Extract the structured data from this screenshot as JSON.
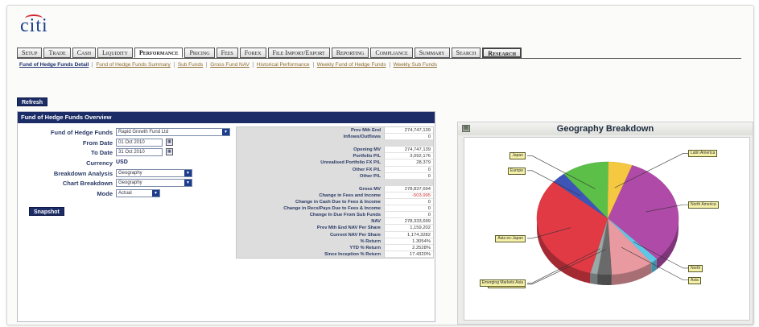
{
  "brand": {
    "logo_text": "citi"
  },
  "tabs": [
    {
      "label": "Setup"
    },
    {
      "label": "Trade"
    },
    {
      "label": "Cash"
    },
    {
      "label": "Liquidity"
    },
    {
      "label": "Performance",
      "active": true
    },
    {
      "label": "Pricing"
    },
    {
      "label": "Fees"
    },
    {
      "label": "Forex"
    },
    {
      "label": "File Import/Export"
    },
    {
      "label": "Reporting"
    },
    {
      "label": "Compliance"
    },
    {
      "label": "Summary"
    },
    {
      "label": "Search"
    },
    {
      "label": "Research"
    }
  ],
  "subnav": [
    "Fund of Hedge Funds Detail",
    "Fund of Hedge Funds Summary",
    "Sub Funds",
    "Gross Fund NAV",
    "Historical Performance",
    "Weekly Fund of Hedge Funds",
    "Weekly Sub Funds"
  ],
  "refresh_label": "Refresh",
  "snapshot_label": "Snapshot",
  "overview": {
    "title": "Fund of Hedge Funds Overview",
    "fund_label": "Fund of Hedge Funds",
    "fund_value": "Rapid Growth Fund Ltd",
    "from_label": "From Date",
    "from_value": "01 Oct 2010",
    "to_label": "To Date",
    "to_value": "31 Oct 2010",
    "currency_label": "Currency",
    "currency_value": "USD",
    "breakdown_label": "Breakdown Analysis",
    "breakdown_value": "Geography",
    "chart_label": "Chart Breakdown",
    "chart_value": "Geography",
    "mode_label": "Mode",
    "mode_value": "Actual"
  },
  "data_rows": [
    {
      "label": "Prev Mth End",
      "value": "274,747,139"
    },
    {
      "label": "Inflows/Outflows",
      "value": "0"
    },
    {
      "gap": true
    },
    {
      "label": "Opening MV",
      "value": "274,747,139"
    },
    {
      "label": "Portfolio P/L",
      "value": "3,092,176"
    },
    {
      "label": "Unrealised Portfolio FX P/L",
      "value": "28,379"
    },
    {
      "label": "Other FX P/L",
      "value": "0"
    },
    {
      "label": "Other P/L",
      "value": "0"
    },
    {
      "gap": true
    },
    {
      "label": "Gross MV",
      "value": "278,837,694"
    },
    {
      "label": "Change in Fees and Income",
      "value": "-503,995",
      "negative": true
    },
    {
      "label": "Change in Cash Due to Fees & Income",
      "value": "0"
    },
    {
      "label": "Change in Recs/Pays Due to Fees & Income",
      "value": "0"
    },
    {
      "label": "Change In Due From Sub Funds",
      "value": "0"
    },
    {
      "label": "NAV",
      "value": "278,333,699"
    },
    {
      "label": "Prev Mth End NAV Per Share",
      "value": "1,159,202"
    },
    {
      "label": "Current NAV Per Share",
      "value": "1,174,3282"
    },
    {
      "label": "% Return",
      "value": "1.3054%"
    },
    {
      "label": "YTD % Return",
      "value": "2.2528%"
    },
    {
      "label": "Since Inception % Return",
      "value": "17.4320%"
    }
  ],
  "chart_data": {
    "type": "pie",
    "title": "Geography Breakdown",
    "slices": [
      {
        "label": "North America",
        "value": 30,
        "color": "#b04aa8"
      },
      {
        "label": "North",
        "value": 1.5,
        "color": "#5cc8e8"
      },
      {
        "label": "Asia",
        "value": 9,
        "color": "#e89aa0"
      },
      {
        "label": "Emerging Markets",
        "value": 3,
        "color": "#6a6a6a"
      },
      {
        "label": "Emerging Markets Asia",
        "value": 1.5,
        "color": "#9aa8a8"
      },
      {
        "label": "Asia ex-Japan",
        "value": 30,
        "color": "#e23a45"
      },
      {
        "label": "Europe",
        "value": 3,
        "color": "#3e55b8"
      },
      {
        "label": "Japan",
        "value": 10,
        "color": "#5cbf48"
      },
      {
        "label": "Latin America",
        "value": 5,
        "color": "#f5c842"
      }
    ]
  }
}
